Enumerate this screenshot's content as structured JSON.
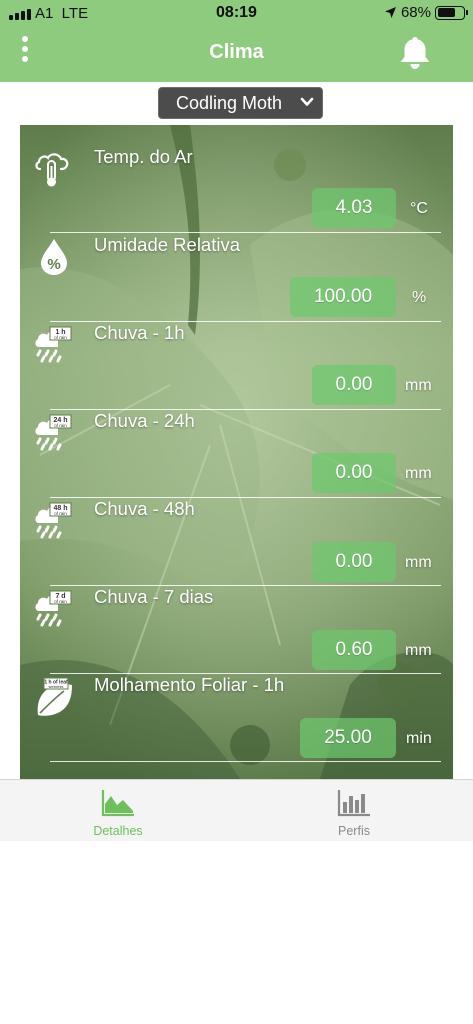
{
  "status_bar": {
    "carrier": "A1  LTE",
    "time": "08:19",
    "battery": "68%",
    "battery_level": 0.68
  },
  "header": {
    "title": "Clima",
    "menu_icon": "more-vertical-icon",
    "bell_icon": "bell-icon"
  },
  "selector": {
    "value": "Codling Moth"
  },
  "rows": [
    {
      "icon": "cloud-thermometer-icon",
      "label": "Temp. do Ar",
      "value": "4.03",
      "unit": "°C"
    },
    {
      "icon": "humidity-drop-icon",
      "label": "Umidade Relativa",
      "value": "100.00",
      "unit": "%"
    },
    {
      "icon": "rain-1h-icon",
      "label": "Chuva - 1h",
      "value": "0.00",
      "unit": "mm",
      "badge_top": "1 h",
      "badge_bottom": "of rain"
    },
    {
      "icon": "rain-24h-icon",
      "label": "Chuva - 24h",
      "value": "0.00",
      "unit": "mm",
      "badge_top": "24 h",
      "badge_bottom": "of rain"
    },
    {
      "icon": "rain-48h-icon",
      "label": "Chuva - 48h",
      "value": "0.00",
      "unit": "mm",
      "badge_top": "48 h",
      "badge_bottom": "of rain"
    },
    {
      "icon": "rain-7d-icon",
      "label": "Chuva - 7 dias",
      "value": "0.60",
      "unit": "mm",
      "badge_top": "7 d",
      "badge_bottom": "of rain"
    },
    {
      "icon": "leaf-wetness-icon",
      "label": "Molhamento Foliar - 1h",
      "value": "25.00",
      "unit": "min",
      "badge_top": "1 h of leaf",
      "badge_bottom": "wetness"
    }
  ],
  "tabs": [
    {
      "label": "Detalhes",
      "icon": "area-chart-icon",
      "active": true
    },
    {
      "label": "Perfis",
      "icon": "bar-chart-icon",
      "active": false
    }
  ],
  "colors": {
    "header_bg": "#8fcb7e",
    "value_box": "#6ec86e",
    "tab_active": "#6fbf5e",
    "tab_inactive": "#8a8a8a"
  }
}
